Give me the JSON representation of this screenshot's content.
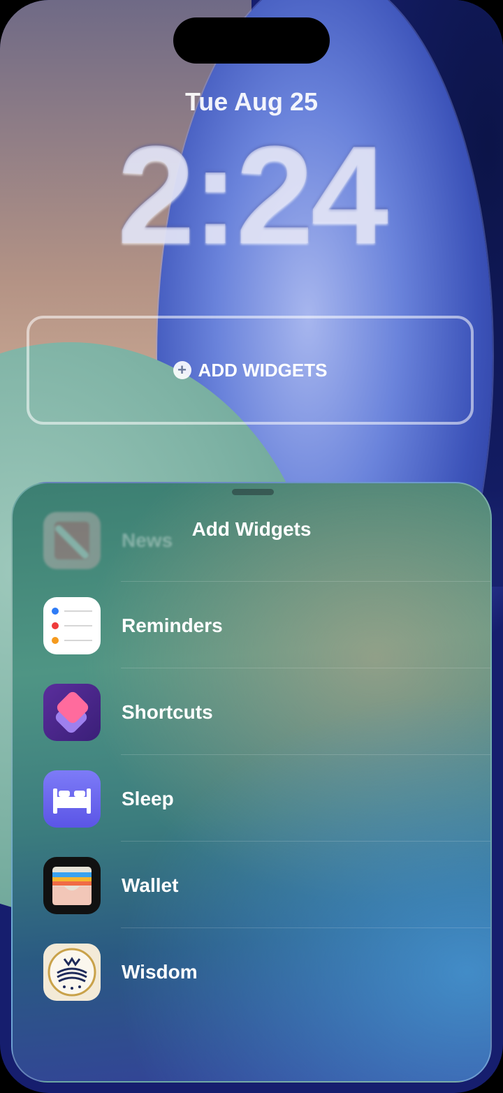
{
  "lock_screen": {
    "date": "Tue Aug 25",
    "time": "2:24",
    "add_widgets_button": "ADD WIDGETS"
  },
  "sheet": {
    "title": "Add Widgets",
    "apps": [
      {
        "label": "News",
        "icon": "news-icon"
      },
      {
        "label": "Reminders",
        "icon": "reminders-icon"
      },
      {
        "label": "Shortcuts",
        "icon": "shortcuts-icon"
      },
      {
        "label": "Sleep",
        "icon": "sleep-icon"
      },
      {
        "label": "Wallet",
        "icon": "wallet-icon"
      },
      {
        "label": "Wisdom",
        "icon": "wisdom-icon"
      }
    ]
  },
  "colors": {
    "accent_sleep": "#6a66f0",
    "accent_shortcuts": "#4a2790"
  }
}
